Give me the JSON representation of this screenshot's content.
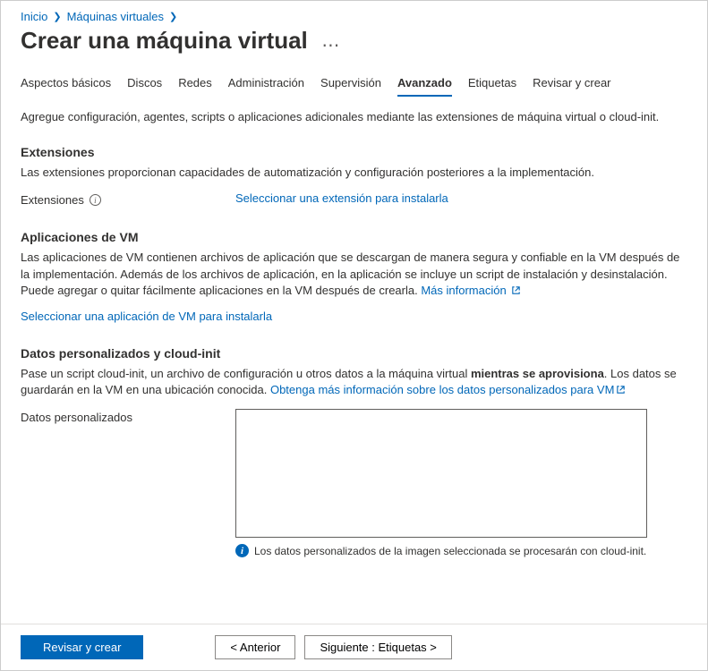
{
  "breadcrumb": {
    "home": "Inicio",
    "vms": "Máquinas virtuales"
  },
  "page_title": "Crear una máquina virtual",
  "tabs": [
    {
      "label": "Aspectos básicos",
      "active": false
    },
    {
      "label": "Discos",
      "active": false
    },
    {
      "label": "Redes",
      "active": false
    },
    {
      "label": "Administración",
      "active": false
    },
    {
      "label": "Supervisión",
      "active": false
    },
    {
      "label": "Avanzado",
      "active": true
    },
    {
      "label": "Etiquetas",
      "active": false
    },
    {
      "label": "Revisar y crear",
      "active": false
    }
  ],
  "intro": "Agregue configuración, agentes, scripts o aplicaciones adicionales mediante las extensiones de máquina virtual o cloud-init.",
  "extensions": {
    "title": "Extensiones",
    "desc": "Las extensiones proporcionan capacidades de automatización y configuración posteriores a la implementación.",
    "field_label": "Extensiones",
    "select_link": "Seleccionar una extensión para instalarla"
  },
  "vm_apps": {
    "title": "Aplicaciones de VM",
    "desc": "Las aplicaciones de VM contienen archivos de aplicación que se descargan de manera segura y confiable en la VM después de la implementación. Además de los archivos de aplicación, en la aplicación se incluye un script de instalación y desinstalación. Puede agregar o quitar fácilmente aplicaciones en la VM después de crearla. ",
    "learn_more": "Más información",
    "select_link": "Seleccionar una aplicación de VM para instalarla"
  },
  "custom_data": {
    "title": "Datos personalizados y cloud-init",
    "desc_pre": "Pase un script cloud-init, un archivo de configuración u otros datos a la máquina virtual ",
    "desc_bold": "mientras se aprovisiona",
    "desc_post": ". Los datos se guardarán en la VM en una ubicación conocida. ",
    "learn_more": "Obtenga más información sobre los datos personalizados para VM",
    "field_label": "Datos personalizados",
    "value": "",
    "note": "Los datos personalizados de la imagen seleccionada se procesarán con cloud-init."
  },
  "footer": {
    "review": "Revisar y crear",
    "prev": "<  Anterior",
    "next": "Siguiente : Etiquetas  >"
  }
}
